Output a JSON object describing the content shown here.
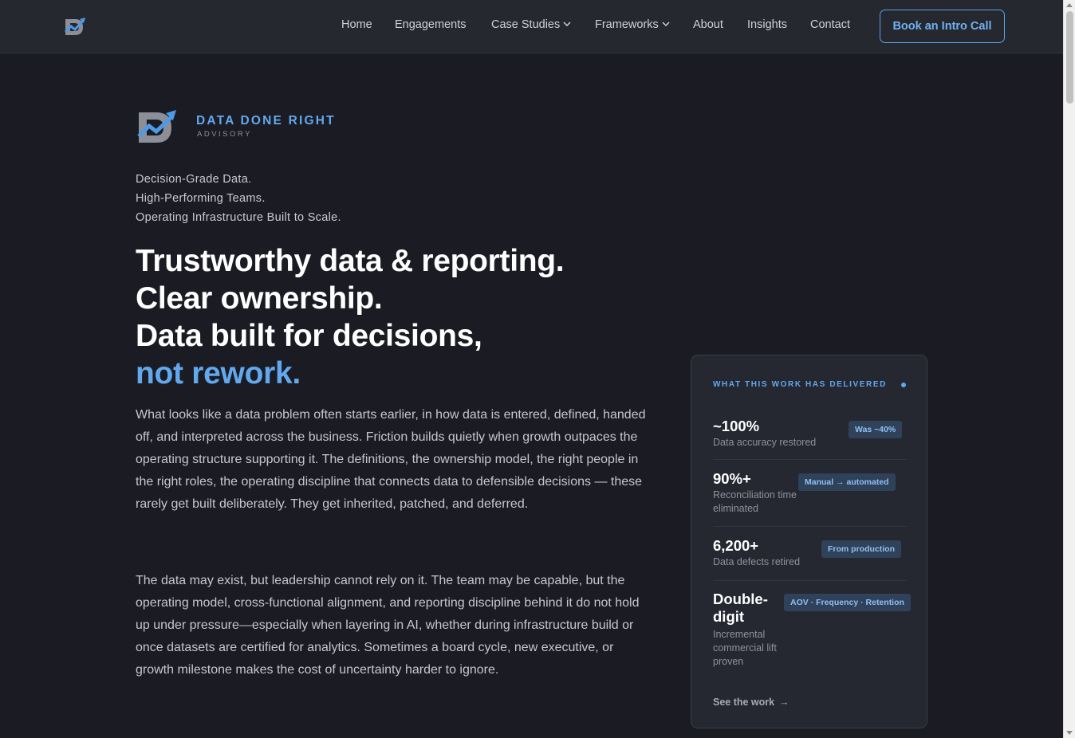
{
  "nav": {
    "items": [
      {
        "label": "Home"
      },
      {
        "label": "Engagements"
      },
      {
        "label": "Case Studies"
      },
      {
        "label": "Frameworks"
      },
      {
        "label": "About"
      },
      {
        "label": "Insights"
      },
      {
        "label": "Contact"
      }
    ],
    "cta": "Book an Intro Call"
  },
  "brand": {
    "name": "DATA DONE RIGHT",
    "sub": "ADVISORY"
  },
  "hero": {
    "taglines": [
      "Decision-Grade Data.",
      "High-Performing Teams.",
      "Operating Infrastructure Built to Scale."
    ],
    "headline": [
      "Trustworthy data & reporting.",
      "Clear ownership.",
      "Data built for decisions,"
    ],
    "headline_accent": "not rework.",
    "paragraphs": [
      "What looks like a data problem often starts earlier, in how data is entered, defined, handed off, and interpreted across the business. Friction builds quietly when growth outpaces the operating structure supporting it. The definitions, the ownership model, the right people in the right roles, the operating discipline that connects data to defensible decisions — these rarely get built deliberately. They get inherited, patched, and deferred.",
      "The data may exist, but leadership cannot rely on it. The team may be capable, but the operating model, cross-functional alignment, and reporting discipline behind it do not hold up under pressure—especially when layering in AI, whether during infrastructure build or once datasets are certified for analytics. Sometimes a board cycle, new executive, or growth milestone makes the cost of uncertainty harder to ignore."
    ]
  },
  "card": {
    "title": "WHAT THIS WORK HAS DELIVERED",
    "stats": [
      {
        "value": "~100%",
        "label": "Data accuracy restored",
        "badge": "Was ~40%"
      },
      {
        "value": "90%+",
        "label": "Reconciliation time eliminated",
        "badge": "Manual → automated"
      },
      {
        "value": "6,200+",
        "label": "Data defects retired",
        "badge": "From production"
      },
      {
        "value": "Double-digit",
        "label": "Incremental commercial lift proven",
        "badge": "AOV · Frequency · Retention"
      }
    ],
    "link": "See the work",
    "link_arrow": "→"
  },
  "colors": {
    "background": "#1b1c23",
    "accent": "#62a8ee",
    "card": "#262831"
  },
  "icons": {
    "logo": "chart-trend-logo-icon",
    "chevron": "chevron-down-icon",
    "arrow": "arrow-right-icon"
  }
}
